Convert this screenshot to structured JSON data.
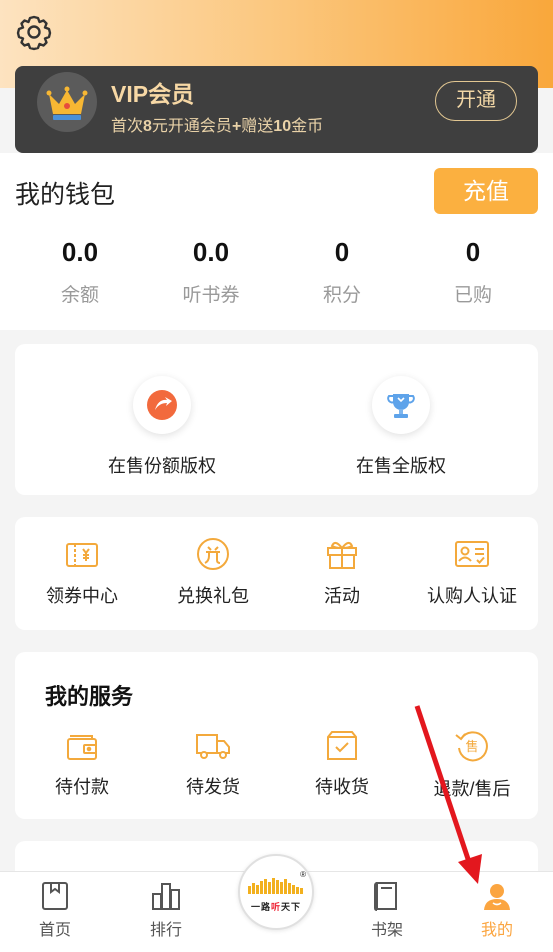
{
  "vip": {
    "title": "VIP会员",
    "subtitle_pre": "首次",
    "subtitle_bold1": "8",
    "subtitle_mid": "元开通会员",
    "subtitle_bold2": "+",
    "subtitle_mid2": "赠送",
    "subtitle_bold3": "10",
    "subtitle_post": "金币",
    "open_label": "开通"
  },
  "wallet": {
    "title": "我的钱包",
    "recharge_label": "充值",
    "stats": [
      {
        "value": "0.0",
        "label": "余额"
      },
      {
        "value": "0.0",
        "label": "听书券"
      },
      {
        "value": "0",
        "label": "积分"
      },
      {
        "value": "0",
        "label": "已购"
      }
    ]
  },
  "copyright": {
    "items": [
      {
        "label": "在售份额版权",
        "icon": "share-copyright-icon"
      },
      {
        "label": "在售全版权",
        "icon": "trophy-icon"
      }
    ]
  },
  "quick": {
    "items": [
      {
        "label": "领券中心",
        "icon": "coupon-icon"
      },
      {
        "label": "兑换礼包",
        "icon": "exchange-icon"
      },
      {
        "label": "活动",
        "icon": "gift-icon"
      },
      {
        "label": "认购人认证",
        "icon": "id-card-icon"
      }
    ]
  },
  "services": {
    "title": "我的服务",
    "items": [
      {
        "label": "待付款",
        "icon": "wallet-icon"
      },
      {
        "label": "待发货",
        "icon": "truck-icon"
      },
      {
        "label": "待收货",
        "icon": "package-icon"
      },
      {
        "label": "退款/售后",
        "icon": "refund-icon"
      }
    ]
  },
  "tabs": [
    {
      "label": "首页",
      "icon": "home-icon"
    },
    {
      "label": "排行",
      "icon": "ranking-icon"
    },
    {
      "label": "书架",
      "icon": "bookshelf-icon"
    },
    {
      "label": "我的",
      "icon": "profile-icon",
      "active": true
    }
  ],
  "logo": {
    "text_a": "一路",
    "text_b": "听",
    "text_c": "天下",
    "mark": "®"
  },
  "colors": {
    "accent": "#fba540",
    "vip_bg": "#3f3f3f",
    "vip_text": "#f7d8a5"
  }
}
